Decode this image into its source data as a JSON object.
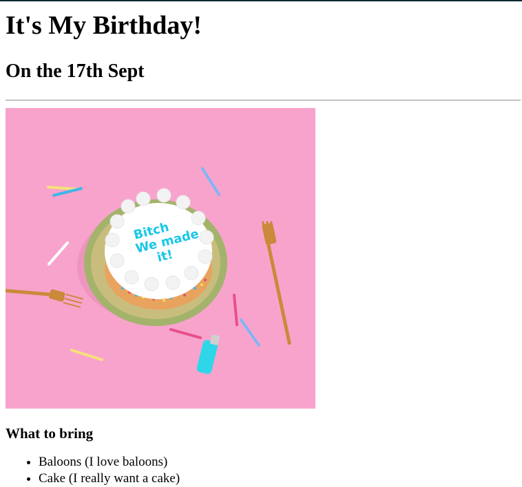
{
  "page": {
    "title": "It's My Birthday!",
    "subtitle": "On the 17th Sept"
  },
  "image": {
    "cake_text": [
      "Bitch",
      "We made",
      "it!"
    ],
    "colors": {
      "background": "#f8a3cc",
      "frosting": "#ffffff",
      "cake_text": "#19c7e6",
      "plate": "#9bb07a",
      "lighter": "#2fd6e8",
      "fork": "#c98a3a"
    }
  },
  "section": {
    "heading": "What to bring",
    "items": [
      "Baloons (I love baloons)",
      "Cake (I really want a cake)"
    ]
  }
}
